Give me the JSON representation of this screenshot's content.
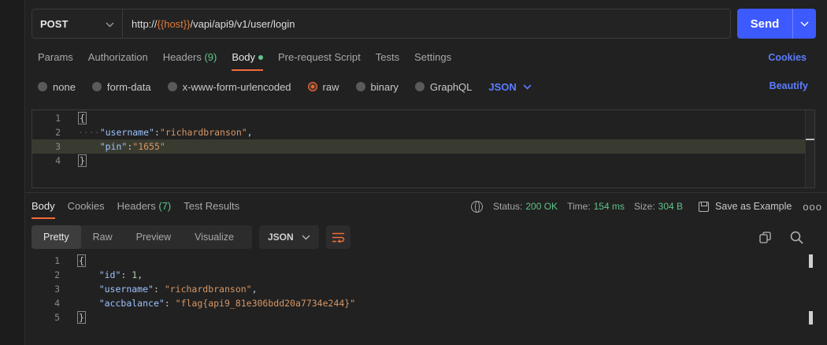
{
  "request": {
    "method": "POST",
    "url_prefix": "http://",
    "url_var": "{{host}}",
    "url_suffix": "/vapi/api9/v1/user/login",
    "send_label": "Send"
  },
  "request_tabs": [
    {
      "label": "Params"
    },
    {
      "label": "Authorization"
    },
    {
      "label": "Headers",
      "count": "(9)"
    },
    {
      "label": "Body",
      "active": true
    },
    {
      "label": "Pre-request Script"
    },
    {
      "label": "Tests"
    },
    {
      "label": "Settings"
    }
  ],
  "cookies_link": "Cookies",
  "body_types": [
    "none",
    "form-data",
    "x-www-form-urlencoded",
    "raw",
    "binary",
    "GraphQL"
  ],
  "body_type_selected": "raw",
  "body_format": "JSON",
  "beautify_label": "Beautify",
  "request_body": {
    "line1": "{",
    "username_key": "\"username\"",
    "username_val": "\"richardbranson\"",
    "pin_key": "\"pin\"",
    "pin_val": "\"1655\"",
    "line4": "}"
  },
  "response_tabs": [
    {
      "label": "Body",
      "active": true
    },
    {
      "label": "Cookies"
    },
    {
      "label": "Headers",
      "count": "(7)"
    },
    {
      "label": "Test Results"
    }
  ],
  "response_meta": {
    "status_label": "Status:",
    "status": "200 OK",
    "time_label": "Time:",
    "time": "154 ms",
    "size_label": "Size:",
    "size": "304 B",
    "save_label": "Save as Example",
    "more": "ooo"
  },
  "view_modes": [
    "Pretty",
    "Raw",
    "Preview",
    "Visualize"
  ],
  "view_selected": "Pretty",
  "response_format": "JSON",
  "response_body": {
    "open": "{",
    "id_key": "\"id\"",
    "id_val": "1",
    "username_key": "\"username\"",
    "username_val": "\"richardbranson\"",
    "acc_key": "\"accbalance\"",
    "acc_val": "\"flag{api9_81e306bdd20a7734e244}\"",
    "close": "}"
  },
  "line_numbers": [
    "1",
    "2",
    "3",
    "4",
    "5"
  ],
  "colors": {
    "accent": "#3d5afe",
    "active_tab": "#f26b3a",
    "status_ok": "#5fc48a",
    "link": "#5b7cff"
  }
}
